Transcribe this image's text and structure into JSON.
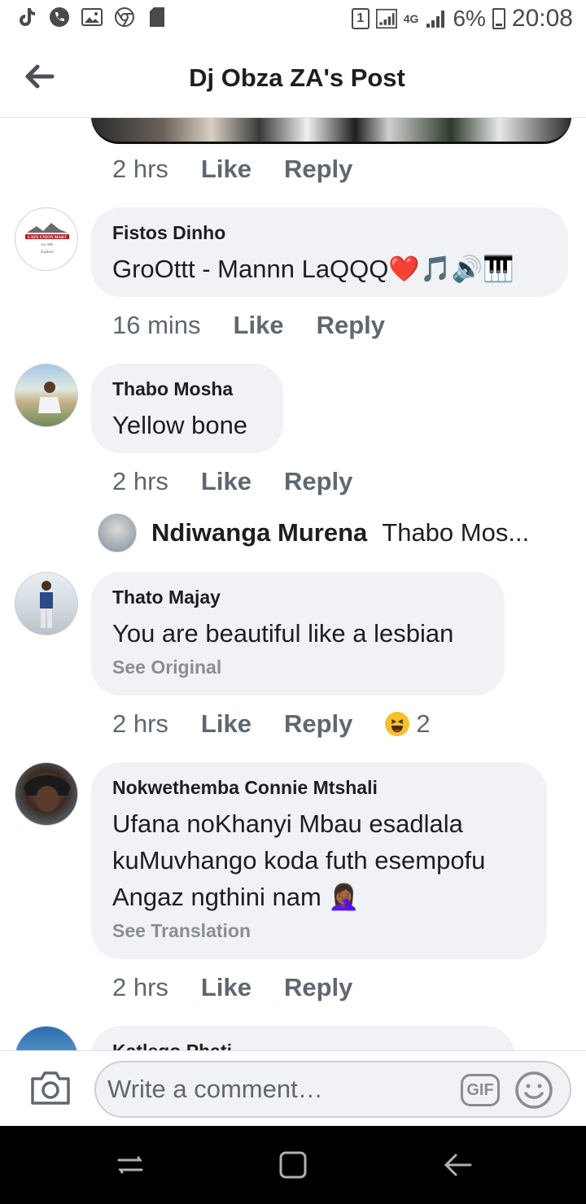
{
  "status_bar": {
    "battery": "6%",
    "time": "20:08",
    "network": "4G",
    "sim": "1",
    "icons": [
      "tiktok-icon",
      "phone-icon",
      "gallery-icon",
      "chrome-icon",
      "sd-card-icon"
    ]
  },
  "header": {
    "title": "Dj Obza ZA's Post",
    "back_icon": "arrow-left-icon"
  },
  "top_actions": {
    "time": "2 hrs",
    "like": "Like",
    "reply": "Reply"
  },
  "comments": [
    {
      "author": "Fistos Dinho",
      "text": "GroOttt - Mannn LaQQQ❤️🎵🔊🎹",
      "time": "16 mins",
      "like": "Like",
      "reply": "Reply",
      "avatar_text": "CAPE UNION MART"
    },
    {
      "author": "Thabo Mosha",
      "text": "Yellow bone",
      "time": "2 hrs",
      "like": "Like",
      "reply": "Reply",
      "reply_preview": {
        "name": "Ndiwanga Murena",
        "text": "Thabo Mos..."
      }
    },
    {
      "author": "Thato Majay",
      "text": "You are beautiful like a lesbian",
      "sub": "See Original",
      "time": "2 hrs",
      "like": "Like",
      "reply": "Reply",
      "reaction_count": "2"
    },
    {
      "author": "Nokwethemba Connie Mtshali",
      "text": "Ufana noKhanyi Mbau esadlala kuMuvhango koda futh esempofu Angaz ngthini nam 🤦🏾‍♀️",
      "sub": "See Translation",
      "time": "2 hrs",
      "like": "Like",
      "reply": "Reply"
    },
    {
      "author": "Katlego Phati"
    }
  ],
  "composer": {
    "placeholder": "Write a comment…",
    "gif_label": "GIF"
  },
  "colors": {
    "bubble_bg": "#f0f2f5",
    "secondary_text": "#606770",
    "primary_text": "#1c1e21"
  }
}
